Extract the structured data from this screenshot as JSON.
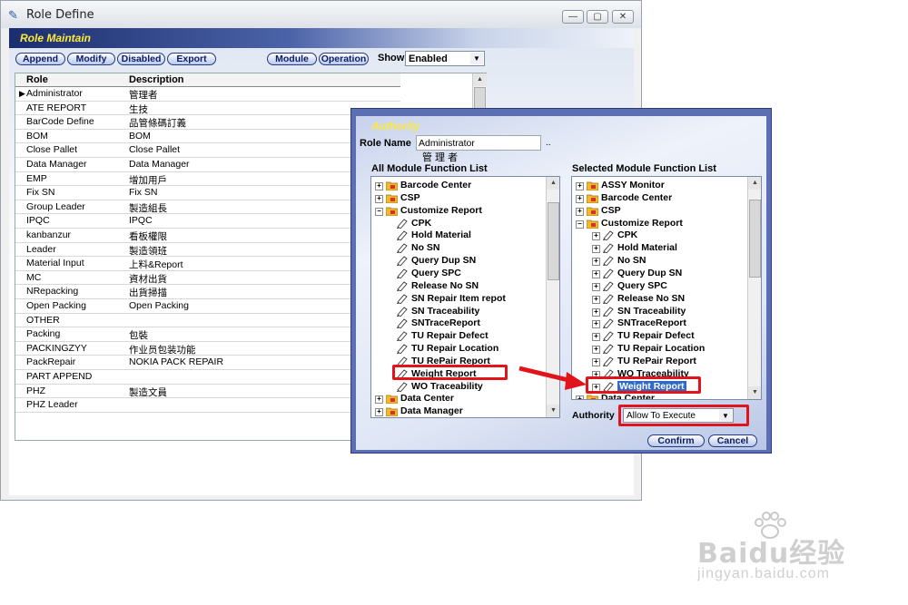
{
  "window": {
    "title": "Role Define",
    "controls": [
      "—",
      "▢",
      "✕"
    ]
  },
  "banner": {
    "title": "Role Maintain"
  },
  "toolbar": {
    "buttons": [
      "Append",
      "Modify",
      "Disabled",
      "Export"
    ],
    "module_label": "Module",
    "operation_label": "Operation",
    "show_label": "Show",
    "show_value": "Enabled"
  },
  "grid": {
    "headers": {
      "role": "Role",
      "description": "Description"
    },
    "rows": [
      {
        "role": "Administrator",
        "description": "管理者"
      },
      {
        "role": "ATE REPORT",
        "description": "生技"
      },
      {
        "role": "BarCode Define",
        "description": "品管條碼訂義"
      },
      {
        "role": "BOM",
        "description": "BOM"
      },
      {
        "role": "Close Pallet",
        "description": "Close Pallet"
      },
      {
        "role": "Data Manager",
        "description": "Data Manager"
      },
      {
        "role": "EMP",
        "description": "增加用戶"
      },
      {
        "role": "Fix SN",
        "description": "Fix SN"
      },
      {
        "role": "Group Leader",
        "description": "製造組長"
      },
      {
        "role": "IPQC",
        "description": "IPQC"
      },
      {
        "role": "kanbanzur",
        "description": "看板權限"
      },
      {
        "role": "Leader",
        "description": "製造領班"
      },
      {
        "role": "Material Input",
        "description": "上料&Report"
      },
      {
        "role": "MC",
        "description": "資材出貨"
      },
      {
        "role": "NRepacking",
        "description": "出貨掃描"
      },
      {
        "role": "Open Packing",
        "description": "Open Packing"
      },
      {
        "role": "OTHER",
        "description": ""
      },
      {
        "role": "Packing",
        "description": "包裝"
      },
      {
        "role": "PACKINGZYY",
        "description": "作业员包装功能"
      },
      {
        "role": "PackRepair",
        "description": "NOKIA PACK REPAIR"
      },
      {
        "role": "PART APPEND",
        "description": ""
      },
      {
        "role": "PHZ",
        "description": "製造文員"
      },
      {
        "role": "PHZ Leader",
        "description": ""
      }
    ]
  },
  "authority": {
    "title": "Authority",
    "role_name_label": "Role Name",
    "role_name_value": "Administrator",
    "role_name_sub": "管 理 者",
    "dots": "..",
    "left_panel_title": "All Module Function List",
    "right_panel_title": "Selected Module Function List",
    "left_tree": [
      {
        "label": "Barcode Center",
        "level": 0,
        "exp": "+"
      },
      {
        "label": "CSP",
        "level": 0,
        "exp": "+"
      },
      {
        "label": "Customize Report",
        "level": 0,
        "exp": "−"
      },
      {
        "label": "CPK",
        "level": 1
      },
      {
        "label": "Hold Material",
        "level": 1
      },
      {
        "label": "No SN",
        "level": 1
      },
      {
        "label": "Query Dup SN",
        "level": 1
      },
      {
        "label": "Query SPC",
        "level": 1
      },
      {
        "label": "Release No SN",
        "level": 1
      },
      {
        "label": "SN Repair Item repot",
        "level": 1
      },
      {
        "label": "SN Traceability",
        "level": 1
      },
      {
        "label": "SNTraceReport",
        "level": 1
      },
      {
        "label": "TU Repair Defect",
        "level": 1
      },
      {
        "label": "TU Repair Location",
        "level": 1
      },
      {
        "label": "TU RePair Report",
        "level": 1
      },
      {
        "label": "Weight Report",
        "level": 1
      },
      {
        "label": "WO Traceability",
        "level": 1
      },
      {
        "label": "Data Center",
        "level": 0,
        "exp": "+"
      },
      {
        "label": "Data Manager",
        "level": 0,
        "exp": "+"
      }
    ],
    "right_tree": [
      {
        "label": "ASSY Monitor",
        "level": 0,
        "exp": "+"
      },
      {
        "label": "Barcode Center",
        "level": 0,
        "exp": "+"
      },
      {
        "label": "CSP",
        "level": 0,
        "exp": "+"
      },
      {
        "label": "Customize Report",
        "level": 0,
        "exp": "−"
      },
      {
        "label": "CPK",
        "level": 1,
        "exp": "+"
      },
      {
        "label": "Hold Material",
        "level": 1,
        "exp": "+"
      },
      {
        "label": "No SN",
        "level": 1,
        "exp": "+"
      },
      {
        "label": "Query Dup SN",
        "level": 1,
        "exp": "+"
      },
      {
        "label": "Query SPC",
        "level": 1,
        "exp": "+"
      },
      {
        "label": "Release No SN",
        "level": 1,
        "exp": "+"
      },
      {
        "label": "SN Traceability",
        "level": 1,
        "exp": "+"
      },
      {
        "label": "SNTraceReport",
        "level": 1,
        "exp": "+"
      },
      {
        "label": "TU Repair Defect",
        "level": 1,
        "exp": "+"
      },
      {
        "label": "TU Repair Location",
        "level": 1,
        "exp": "+"
      },
      {
        "label": "TU RePair Report",
        "level": 1,
        "exp": "+"
      },
      {
        "label": "WO Traceability",
        "level": 1,
        "exp": "+"
      },
      {
        "label": "Weight Report",
        "level": 1,
        "exp": "+",
        "selected": true
      },
      {
        "label": "Data Center",
        "level": 0,
        "exp": "+"
      }
    ],
    "authority_label": "Authority",
    "authority_value": "Allow To Execute",
    "confirm_label": "Confirm",
    "cancel_label": "Cancel"
  },
  "watermark": {
    "brand": "Baidu经验",
    "url": "jingyan.baidu.com"
  },
  "colors": {
    "highlight_red": "#e1141c",
    "selection_blue": "#316ac5",
    "banner_yellow": "#ffea3a"
  }
}
